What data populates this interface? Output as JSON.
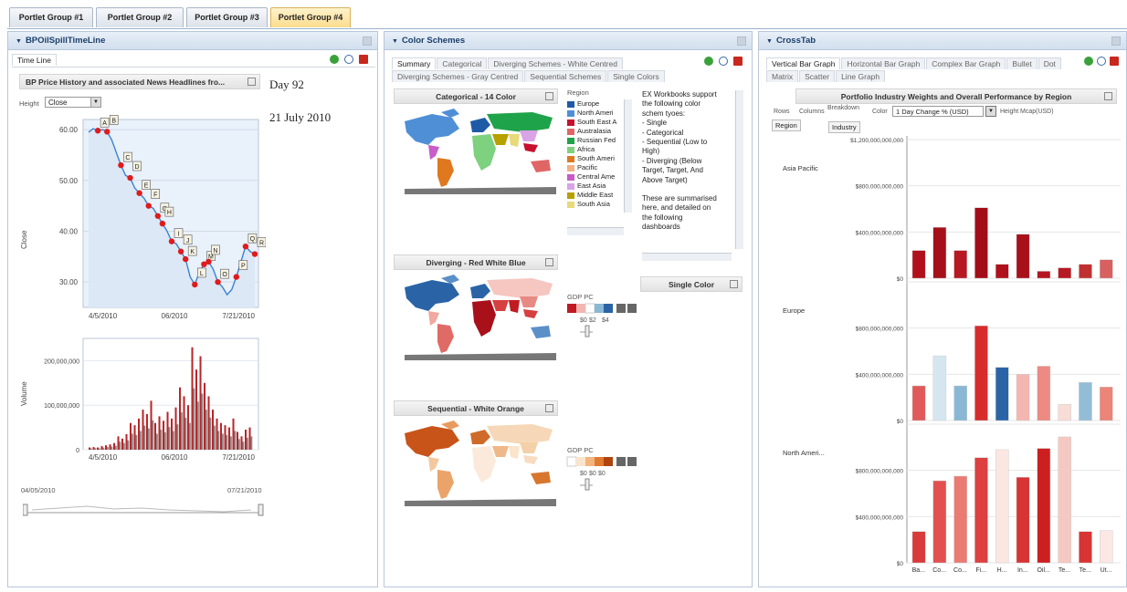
{
  "portlet_tabs": [
    {
      "label": "Portlet Group #1"
    },
    {
      "label": "Portlet Group #2"
    },
    {
      "label": "Portlet Group #3"
    },
    {
      "label": "Portlet Group #4"
    }
  ],
  "left_panel": {
    "title": "BPOilSpillTimeLine",
    "tab": "Time Line",
    "chart_title": "BP Price History and associated News Headlines fro...",
    "day_label": "Day 92",
    "date_label": "21 July 2010",
    "height_label": "Height",
    "height_value": "Close",
    "price_ylabel": "Close",
    "volume_ylabel": "Volume",
    "range_start": "04/05/2010",
    "range_end": "07/21/2010"
  },
  "middle_panel": {
    "title": "Color Schemes",
    "tabs_row1": [
      "Summary",
      "Categorical",
      "Diverging Schemes - White Centred"
    ],
    "tabs_row2": [
      "Diverging Schemes - Gray Centred",
      "Sequential Schemes",
      "Single Colors"
    ],
    "cat_title": "Categorical - 14 Color",
    "div_title": "Diverging - Red White Blue",
    "seq_title": "Sequential - White Orange",
    "single_title": "Single Color",
    "region_label": "Region",
    "regions": [
      {
        "label": "Europe",
        "color": "#1f5aa6"
      },
      {
        "label": "North Ameri",
        "color": "#4f8fd6"
      },
      {
        "label": "South East A",
        "color": "#c8102e"
      },
      {
        "label": "Australasia",
        "color": "#e06666"
      },
      {
        "label": "Russian Fed",
        "color": "#1fa34a"
      },
      {
        "label": "Africa",
        "color": "#7ed17e"
      },
      {
        "label": "South Ameri",
        "color": "#e0781f"
      },
      {
        "label": "Pacific",
        "color": "#f4b183"
      },
      {
        "label": "Central Ame",
        "color": "#c85cc8"
      },
      {
        "label": "East Asia",
        "color": "#d9a3e6"
      },
      {
        "label": "Middle East",
        "color": "#b8a000"
      },
      {
        "label": "South Asia",
        "color": "#e8d97a"
      }
    ],
    "gdp_label": "GDP PC",
    "div_ticks": [
      "$0",
      "$2",
      "$4"
    ],
    "seq_ticks": [
      "$0",
      "$0",
      "$0"
    ],
    "info_text": [
      "EX Workbooks support",
      "the following color",
      "schem tyoes:",
      "- Single",
      "- Categorical",
      "- Sequential (Low to",
      "High)",
      "- Diverging (Below",
      "Target, Target, And",
      "Above Target)",
      "",
      "These are summarised",
      "here, and detailed on",
      "the following",
      "dashboards"
    ]
  },
  "right_panel": {
    "title": "CrossTab",
    "tabs_row1": [
      "Vertical Bar Graph",
      "Horizontal Bar Graph",
      "Complex Bar Graph",
      "Bullet",
      "Dot"
    ],
    "tabs_row2": [
      "Matrix",
      "Scatter",
      "Line Graph"
    ],
    "chart_title": "Portfolio Industry Weights and Overall Performance by Region",
    "rows_label": "Rows",
    "rows_value": "Region",
    "columns_label": "Columns",
    "breakdown_label": "Breakdown",
    "breakdown_value": "Industry",
    "color_label": "Color",
    "color_value": "1 Day Change % (USD)",
    "height_label": "Height",
    "height_value": "Mcap(USD)"
  },
  "chart_data": [
    {
      "type": "line",
      "x_ticks": [
        "4/5/2010",
        "06/2010",
        "7/21/2010"
      ],
      "y_ticks": [
        "60.00",
        "50.00",
        "40.00",
        "30.00"
      ],
      "ylabel": "Close",
      "ylim": [
        25,
        62
      ],
      "values": [
        59.5,
        60.2,
        59.8,
        60.0,
        59.6,
        58.0,
        55.5,
        53.0,
        51.0,
        50.5,
        48.5,
        47.5,
        46.5,
        45.0,
        44.5,
        43.0,
        41.5,
        40.0,
        38.0,
        37.5,
        36.0,
        34.5,
        31.0,
        29.5,
        32.0,
        33.5,
        34.0,
        32.5,
        30.0,
        29.0,
        27.5,
        28.5,
        31.0,
        34.0,
        37.0,
        36.0,
        35.5
      ],
      "headline_markers": [
        "A",
        "B",
        "C",
        "D",
        "E",
        "F",
        "G",
        "H",
        "I",
        "J",
        "K",
        "L",
        "M",
        "N",
        "O",
        "P",
        "Q",
        "R"
      ]
    },
    {
      "type": "bar",
      "x_ticks": [
        "4/5/2010",
        "06/2010",
        "7/21/2010"
      ],
      "y_ticks": [
        "200,000,000",
        "100,000,000",
        "0"
      ],
      "ylabel": "Volume",
      "ylim": [
        0,
        250000000
      ],
      "values": [
        5,
        6,
        5,
        8,
        10,
        12,
        15,
        30,
        25,
        35,
        60,
        55,
        70,
        90,
        80,
        110,
        60,
        75,
        65,
        85,
        70,
        95,
        140,
        120,
        100,
        230,
        180,
        210,
        150,
        120,
        90,
        70,
        60,
        55,
        50,
        70,
        40,
        30,
        45,
        50
      ]
    },
    {
      "type": "bar",
      "title": "Portfolio Industry Weights and Overall Performance by Region",
      "y_ticks": [
        "$1,200,000,000,000",
        "$800,000,000,000",
        "$400,000,000,000",
        "$0"
      ],
      "ylim": [
        0,
        1200
      ],
      "categories": [
        "Ba...",
        "Co...",
        "Co...",
        "Fi...",
        "H...",
        "In...",
        "Oil...",
        "Te...",
        "Te...",
        "Ut..."
      ],
      "series": [
        {
          "name": "Asia Pacific",
          "values": [
            240,
            440,
            240,
            610,
            120,
            380,
            60,
            90,
            120,
            160
          ],
          "colors": [
            "#b0101c",
            "#a5101a",
            "#b81822",
            "#a30d18",
            "#b0101c",
            "#a8101a",
            "#b51520",
            "#b81822",
            "#c03030",
            "#d86060"
          ]
        },
        {
          "name": "Europe",
          "values": [
            300,
            560,
            300,
            820,
            460,
            400,
            470,
            140,
            330,
            290
          ],
          "colors": [
            "#e05a5a",
            "#d6e6f0",
            "#8ab8d4",
            "#d82c2c",
            "#2a64a6",
            "#f3b6b0",
            "#ec8a84",
            "#f8dcd6",
            "#93bdd6",
            "#ec8478"
          ]
        },
        {
          "name": "North Ameri...",
          "values": [
            270,
            710,
            750,
            910,
            980,
            740,
            990,
            1090,
            270,
            280
          ],
          "colors": [
            "#d93a3a",
            "#e25050",
            "#eb7a72",
            "#dc4040",
            "#fbe6e2",
            "#d83434",
            "#cc2020",
            "#f6c8c2",
            "#d83434",
            "#fbe8e4"
          ]
        }
      ]
    }
  ]
}
